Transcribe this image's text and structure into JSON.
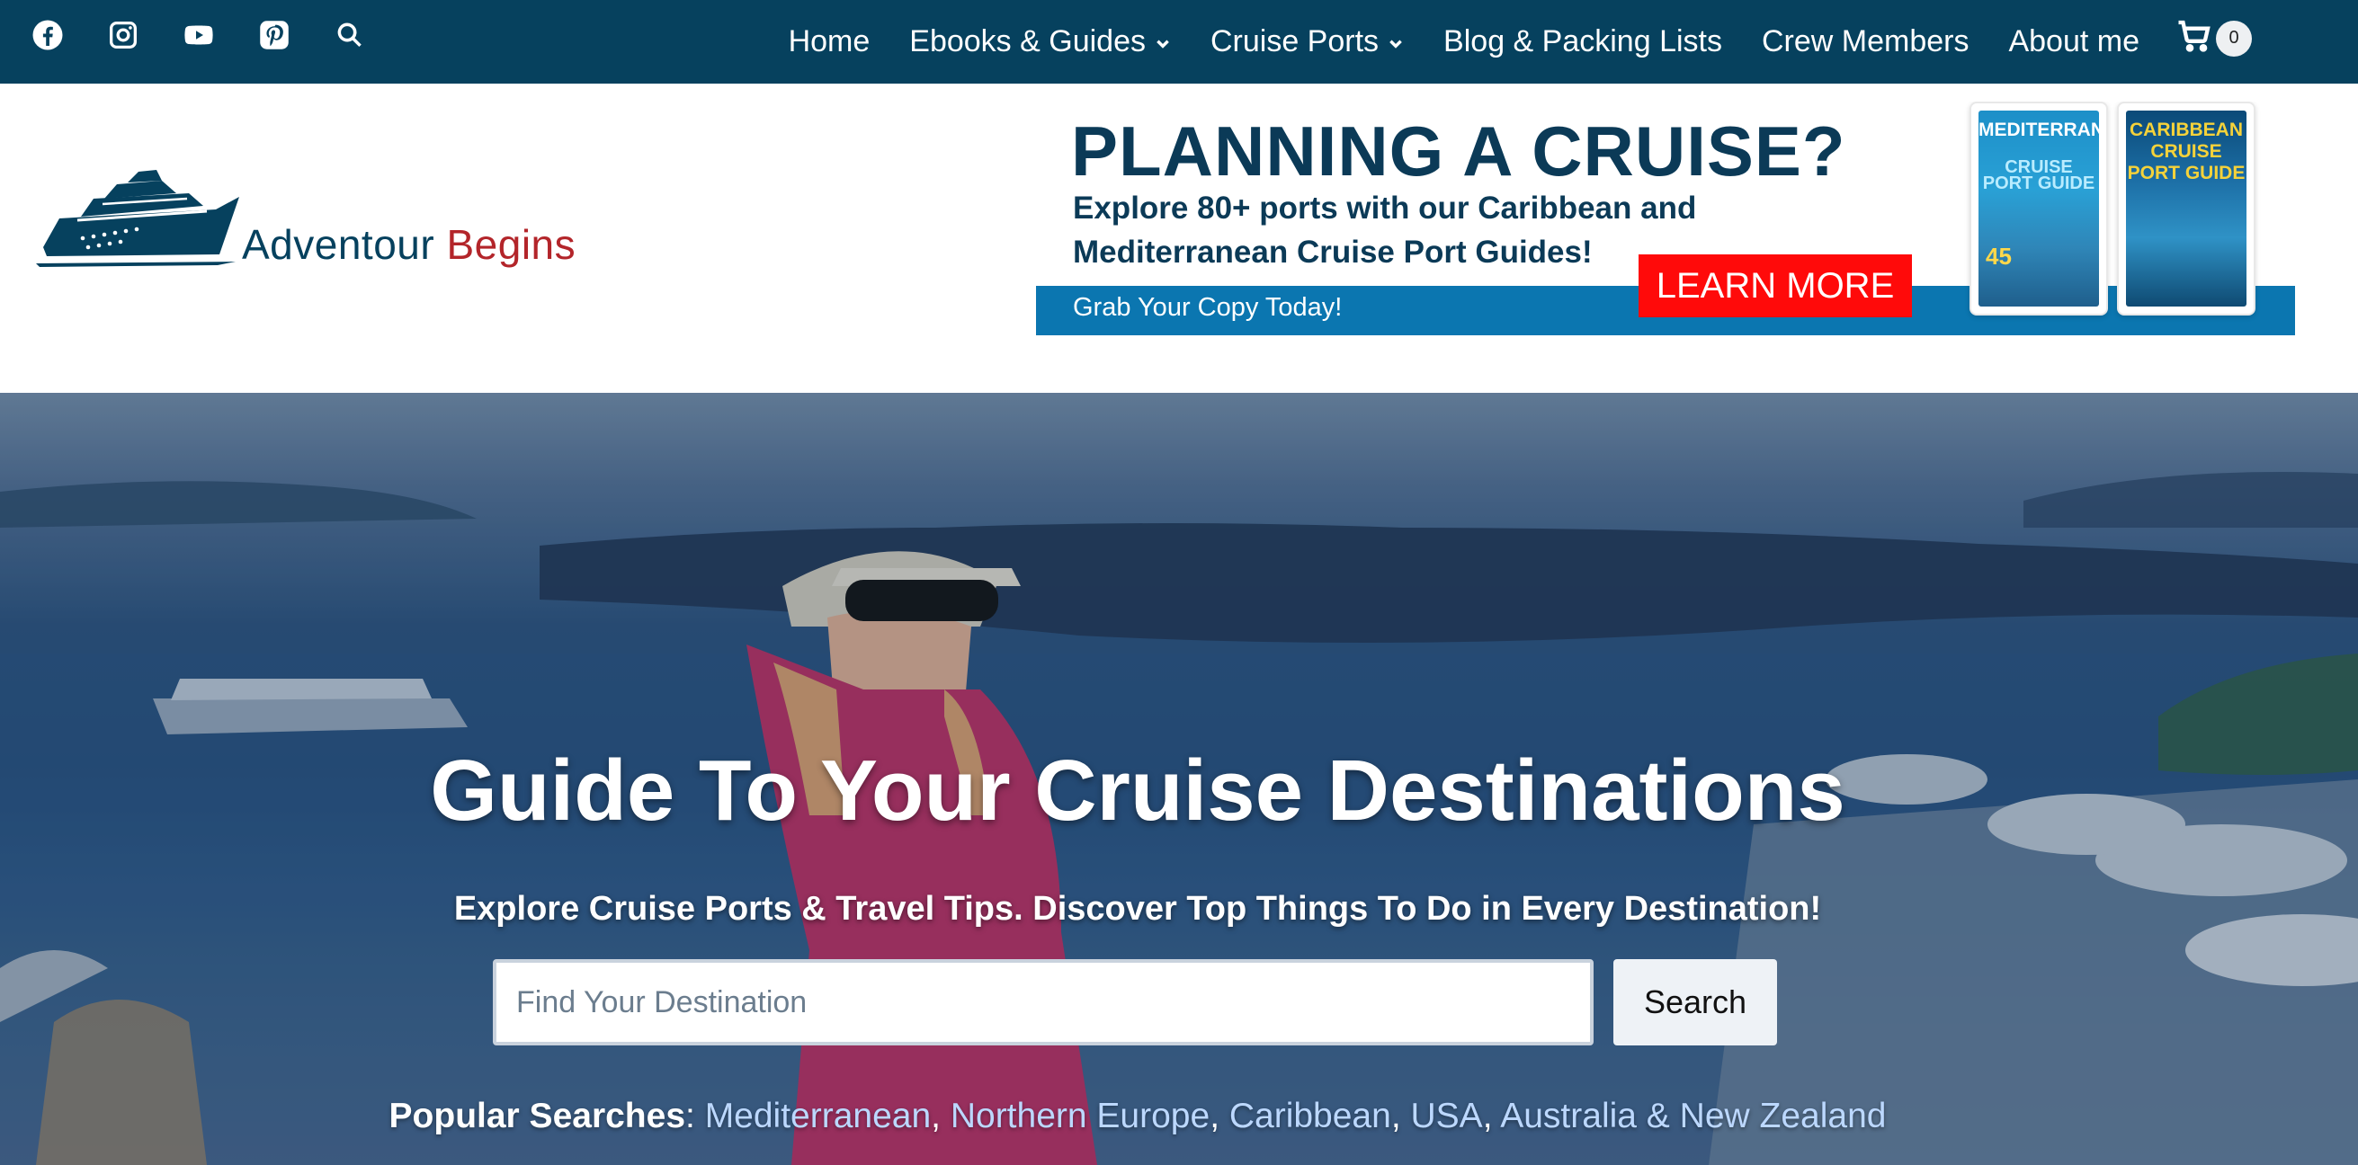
{
  "topbar": {
    "social_icons": [
      "facebook-icon",
      "instagram-icon",
      "youtube-icon",
      "pinterest-icon",
      "search-icon"
    ],
    "nav": [
      {
        "label": "Home",
        "dropdown": false
      },
      {
        "label": "Ebooks & Guides",
        "dropdown": true
      },
      {
        "label": "Cruise Ports",
        "dropdown": true
      },
      {
        "label": "Blog & Packing Lists",
        "dropdown": false
      },
      {
        "label": "Crew Members",
        "dropdown": false
      },
      {
        "label": "About me",
        "dropdown": false
      }
    ],
    "cart_count": "0"
  },
  "logo": {
    "word1": "Adventour",
    "word2": "Begins"
  },
  "banner": {
    "title": "PLANNING A CRUISE?",
    "subtitle": "Explore 80+ ports with our Caribbean and Mediterranean Cruise Port Guides!",
    "copy": "Grab Your Copy Today!",
    "button": "LEARN MORE",
    "book1": {
      "title": "MEDITERRANEAN",
      "subtitle": "CRUISE PORT GUIDE",
      "number": "45"
    },
    "book2": {
      "title": "CARIBBEAN CRUISE PORT GUIDE"
    }
  },
  "hero": {
    "title": "Guide To Your Cruise Destinations",
    "subtitle": "Explore Cruise Ports & Travel Tips. Discover Top Things To Do in Every Destination!",
    "search_placeholder": "Find Your Destination",
    "search_button": "Search",
    "popular_label": "Popular Searches",
    "popular_links": [
      "Mediterranean",
      "Northern Europe",
      "Caribbean",
      "USA",
      "Australia & New Zealand"
    ]
  },
  "colors": {
    "topbar": "#06415e",
    "brand_red": "#b3252a",
    "banner_strip": "#0b76b0",
    "button_red": "#ff0a0a"
  }
}
